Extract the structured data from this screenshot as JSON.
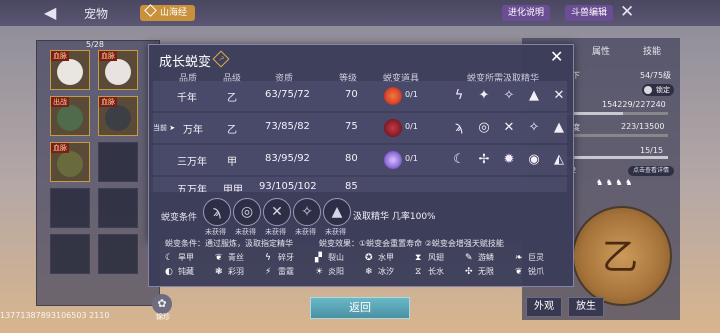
{
  "header": {
    "back_icon": "back-arrow-icon",
    "title": "宠物",
    "tag": "山海经",
    "btn_evolve": "进化说明",
    "btn_fight": "斗兽编辑",
    "close_icon": "close-icon"
  },
  "left": {
    "count": "5/28",
    "slots": [
      {
        "label": "血脉",
        "color": "#e9e5e0"
      },
      {
        "label": "血脉",
        "color": "#e8e2e0"
      },
      {
        "label": "出战",
        "color": "#4f6b4b"
      },
      {
        "label": "血脉",
        "color": "#3c3f46"
      },
      {
        "label": "血脉",
        "color": "#6a6b3c"
      }
    ]
  },
  "modal": {
    "title": "成长蜕变",
    "headers": [
      "品质",
      "品级",
      "资质",
      "等级",
      "蜕变道具",
      "蜕变所需汲取精华"
    ],
    "current_marker": "当前",
    "rows": [
      {
        "quality": "千年",
        "grade": "乙",
        "aptitude": "63/75/72",
        "level": "70",
        "item_count": "0/1",
        "orb_color": "#d6442a",
        "essences": [
          "ϟ",
          "✦",
          "✧",
          "▲",
          "✕"
        ]
      },
      {
        "quality": "万年",
        "grade": "乙",
        "aptitude": "73/85/82",
        "level": "75",
        "item_count": "0/1",
        "orb_color": "#8a1e2a",
        "essences": [
          "ϡ",
          "◎",
          "✕",
          "✧",
          "▲"
        ]
      },
      {
        "quality": "三万年",
        "grade": "甲",
        "aptitude": "83/95/92",
        "level": "80",
        "item_count": "0/1",
        "orb_color": "#8e6cd8",
        "essences": [
          "☾",
          "✢",
          "✹",
          "◉",
          "◭"
        ]
      },
      {
        "quality": "五万年",
        "grade": "甲甲",
        "aptitude": "93/105/102",
        "level": "85"
      }
    ],
    "condition_label": "蜕变条件",
    "conditions": [
      "未获得",
      "未获得",
      "未获得",
      "未获得",
      "未获得"
    ],
    "condition_hint": "汲取精华 几率100%",
    "condition_line": "蜕变条件：通过服炼，汲取指定精华",
    "effect_line": "蜕变效果：①蜕变会重置寿命  ②蜕变会增强天赋技能",
    "skills": [
      [
        "旱甲",
        "青丝",
        "碎牙",
        "裂山",
        "水甲",
        "风翅",
        "游鳞",
        "巨灵"
      ],
      [
        "钝藏",
        "彩羽",
        "雷霆",
        "炎阳",
        "冰汐",
        "长水",
        "无限",
        "锐爪"
      ]
    ]
  },
  "bottom": {
    "return_button": "返回",
    "bag_label": "锦珍",
    "uid": "13771387893106503 2110"
  },
  "right": {
    "tab1": "属性",
    "tab2": "技能",
    "level_text": "54/75级",
    "level_label": "下",
    "lock_label": "锁定",
    "exp_text": "154229/227240",
    "stat_label": "度",
    "stat_value": "223/13500",
    "life_value": "15/15",
    "talent_label": "12",
    "detail_btn": "点击查看详情",
    "medallion_char": "乙",
    "btn_appearance": "外观",
    "btn_release": "放生"
  }
}
